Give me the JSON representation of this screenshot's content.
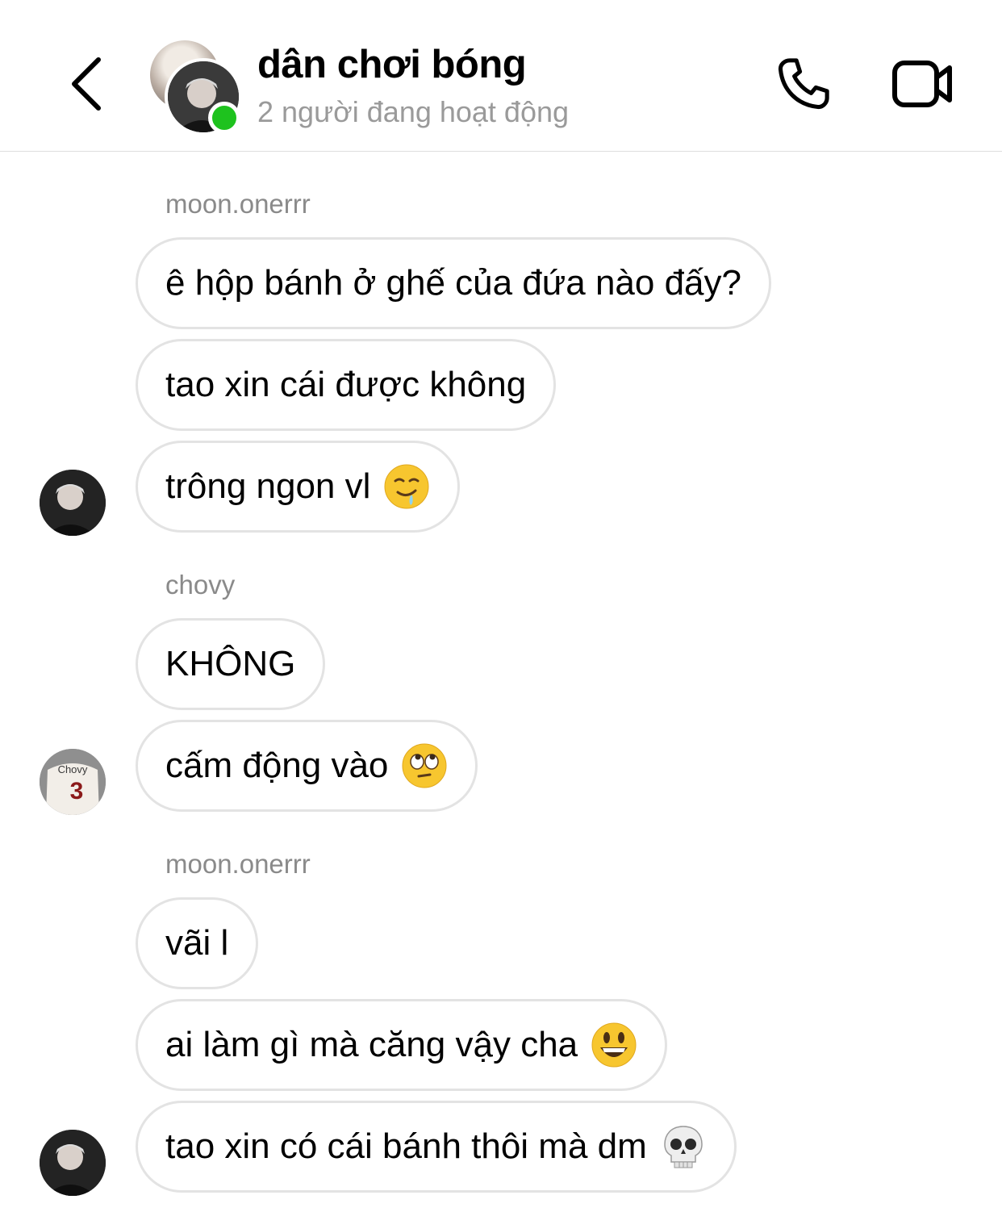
{
  "header": {
    "title": "dân chơi bóng",
    "subtitle": "2 người đang hoạt động",
    "icons": [
      "back-arrow-icon",
      "phone-icon",
      "video-camera-icon"
    ]
  },
  "avatar_labels": {
    "chovy_jersey": "Chovy",
    "chovy_number": "3"
  },
  "messages": [
    {
      "sender": "moon.onerrr"
    },
    {
      "text": "ê hộp bánh ở ghế của đứa nào đấy?"
    },
    {
      "text": "tao xin cái được không"
    },
    {
      "text": "trông ngon vl",
      "emoji": "drooling-face"
    },
    {
      "sender": "chovy"
    },
    {
      "text": "KHÔNG"
    },
    {
      "text": "cấm động vào",
      "emoji": "face-with-rolling-eyes"
    },
    {
      "sender": "moon.onerrr"
    },
    {
      "text": "vãi l"
    },
    {
      "text": "ai làm gì mà căng vậy cha",
      "emoji": "grinning-face-big-eyes"
    },
    {
      "text": "tao xin có cái bánh thôi mà dm",
      "emoji": "skull"
    }
  ],
  "colors": {
    "online": "#1ec21e",
    "bubble_border": "#e3e3e3",
    "muted_text": "#8a8a8a",
    "header_border": "#dedede"
  }
}
